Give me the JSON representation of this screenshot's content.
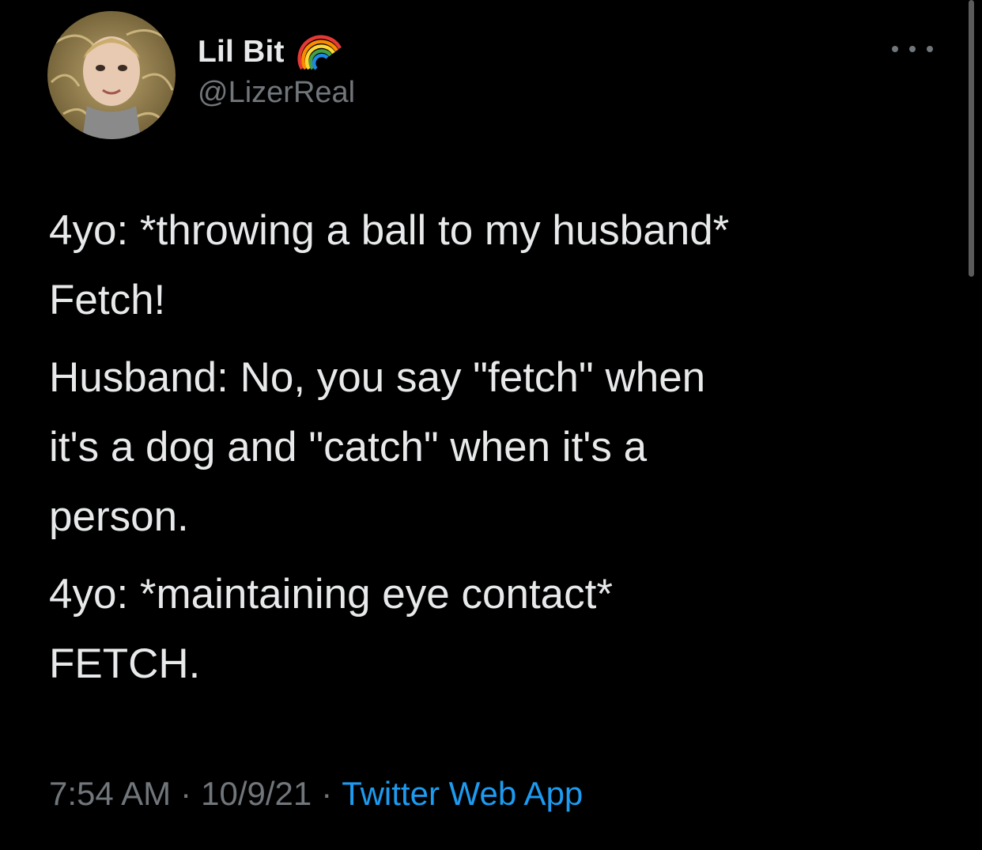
{
  "author": {
    "display_name": "Lil Bit",
    "handle": "@LizerReal",
    "badge_icon": "rainbow-icon",
    "avatar_icon": "profile-photo"
  },
  "menu": {
    "icon": "more-horizontal-icon"
  },
  "tweet": {
    "paragraphs": [
      {
        "line1": "4yo: *throwing a ball to my husband*",
        "line2": "Fetch!"
      },
      {
        "line1": "Husband: No, you say \"fetch\" when",
        "line2": "it's a dog and \"catch\" when it's a",
        "line3": "person."
      },
      {
        "line1": "4yo: *maintaining eye contact*",
        "line2": "FETCH."
      }
    ]
  },
  "meta": {
    "time": "7:54 AM",
    "separator": "·",
    "date": "10/9/21",
    "source": "Twitter Web App"
  },
  "colors": {
    "background": "#000000",
    "text": "#e7e9ea",
    "secondary": "#71767b",
    "link": "#1d9bf0"
  }
}
